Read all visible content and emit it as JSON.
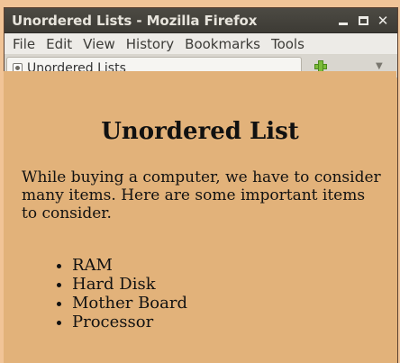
{
  "window": {
    "title": "Unordered Lists - Mozilla Firefox"
  },
  "menu": {
    "items": [
      {
        "label": "File"
      },
      {
        "label": "Edit"
      },
      {
        "label": "View"
      },
      {
        "label": "History"
      },
      {
        "label": "Bookmarks"
      },
      {
        "label": "Tools"
      }
    ]
  },
  "tabs": [
    {
      "label": "Unordered Lists"
    }
  ],
  "page": {
    "heading": "Unordered List",
    "paragraph": "While buying a computer, we have to consider many items. Here are some important items to consider.",
    "list": [
      "RAM",
      "Hard Disk",
      "Mother Board",
      "Processor"
    ]
  },
  "colors": {
    "page_background": "#e2b27a",
    "titlebar": "#3d3b35",
    "menubar": "#edebe7"
  },
  "icons": {
    "favicon": "page-icon",
    "new_tab": "plus-icon",
    "tab_list": "chevron-down-icon"
  }
}
